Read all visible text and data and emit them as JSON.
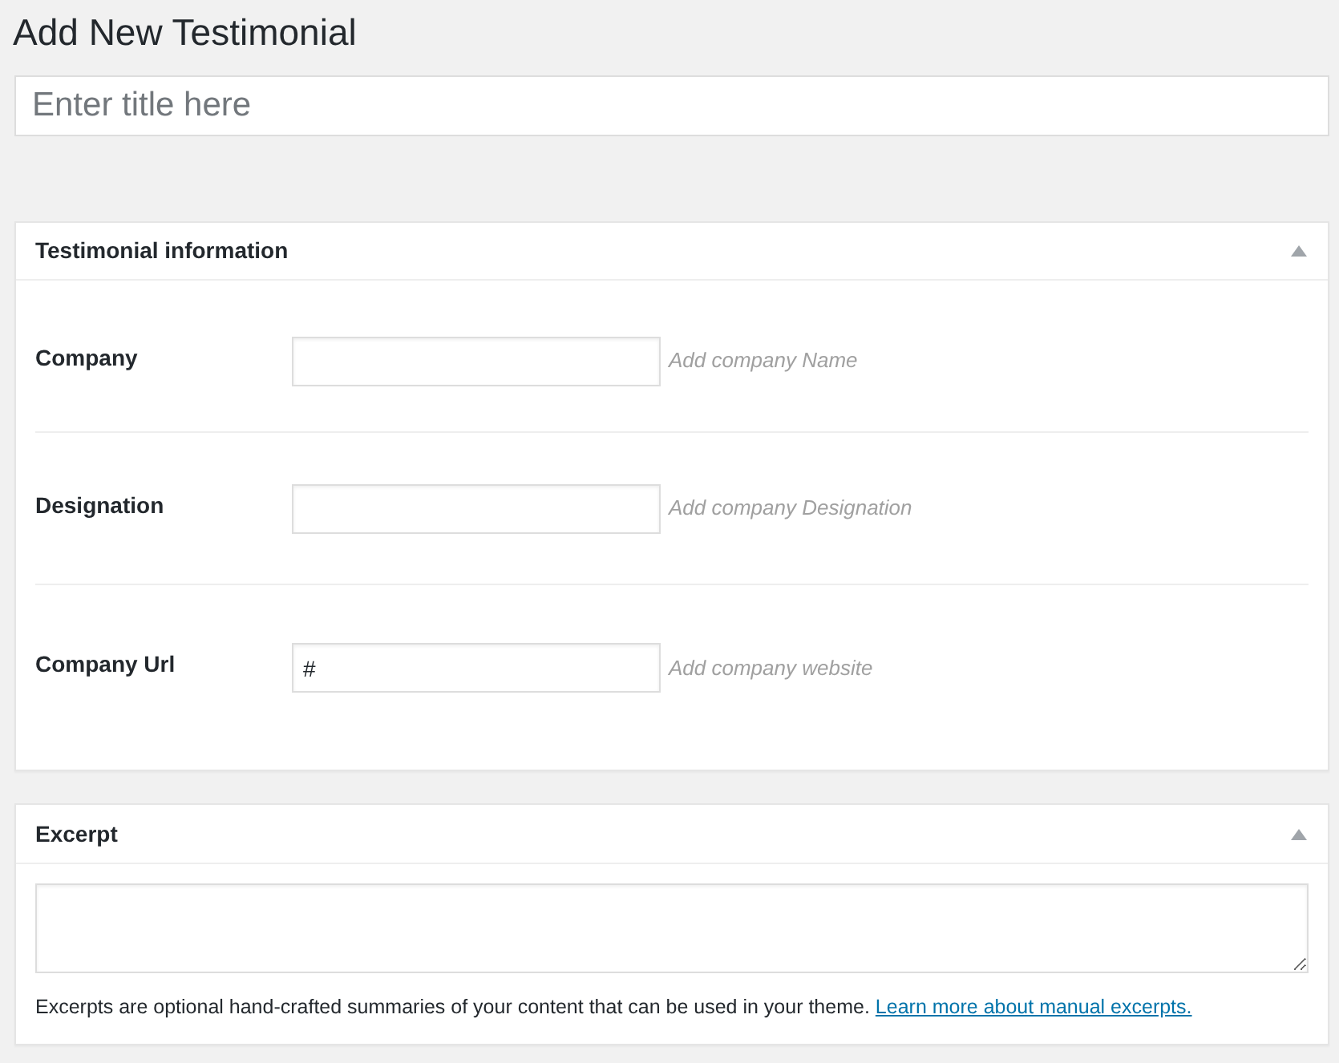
{
  "page_title": "Add New Testimonial",
  "title_field": {
    "placeholder": "Enter title here"
  },
  "testimonial_panel": {
    "title": "Testimonial information",
    "expanded": true,
    "fields": [
      {
        "label": "Company",
        "hint": "Add company Name"
      },
      {
        "label": "Designation",
        "hint": "Add company Designation"
      },
      {
        "label": "Company Url",
        "value": "#",
        "hint": "Add company website"
      }
    ]
  },
  "excerpt_panel": {
    "title": "Excerpt",
    "expanded": true,
    "help_text": "Excerpts are optional hand-crafted summaries of your content that can be used in your theme.",
    "link": "Learn more about manual excerpts."
  }
}
